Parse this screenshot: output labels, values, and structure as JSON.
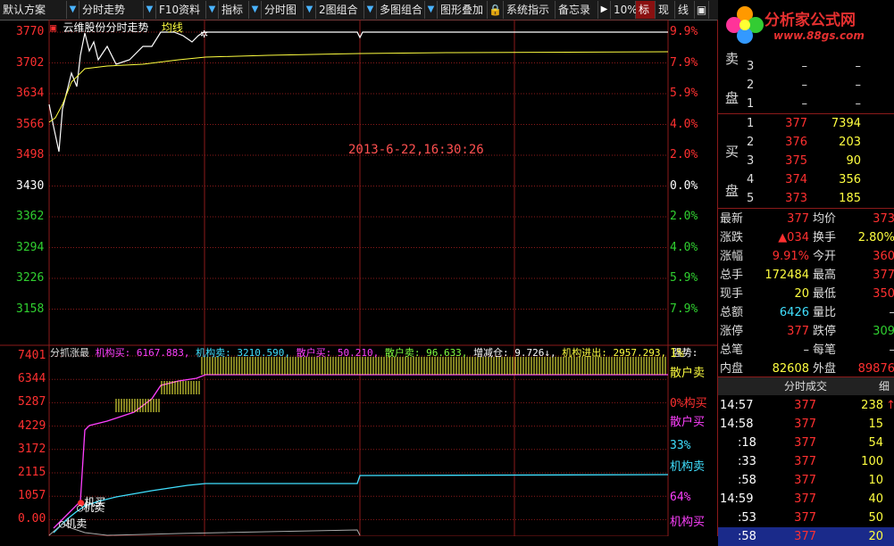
{
  "toolbar": {
    "items": [
      "默认方案",
      "分时走势",
      "F10资料",
      "指标",
      "分时图",
      "2图组合",
      "多图组合",
      "图形叠加",
      "系统指示",
      "备忘录",
      "10%",
      "标",
      "现",
      "线"
    ],
    "lock_label": "🔒"
  },
  "logo": {
    "name": "分析家公式网",
    "url": "www.88gs.com"
  },
  "colors": {
    "up": "#ff3030",
    "down": "#30d030",
    "flat": "#ffffff",
    "yellow": "#ffff40",
    "cyan": "#40e0ff",
    "magenta": "#ff40ff",
    "grid": "#8b1a1a"
  },
  "upper_chart": {
    "title_prefix": "云维股份分时走势",
    "avg_label": "均线",
    "timestamp": "2013-6-22,16:30:26",
    "price_ticks": [
      "3770",
      "3702",
      "3634",
      "3566",
      "3498",
      "3430",
      "3362",
      "3294",
      "3226",
      "3158"
    ],
    "pct_ticks": [
      "9.9%",
      "7.9%",
      "5.9%",
      "4.0%",
      "2.0%",
      "0.0%",
      "2.0%",
      "4.0%",
      "5.9%",
      "7.9%"
    ]
  },
  "lower_chart": {
    "legend": {
      "name": "分抓涨最",
      "inst_buy": "机构买: 6167.883,",
      "inst_sell": "机构卖: 3210.590,",
      "retail_buy": "散户买: 50.210,",
      "retail_sell": "散户卖: 96.633,",
      "position": "增减仓: 9.726↓,",
      "net": "机构进出: 2957.293,",
      "strength": "强势:"
    },
    "y_ticks": [
      "7401",
      "6344",
      "5287",
      "4229",
      "3172",
      "2115",
      "1057",
      "0.00"
    ],
    "right_labels": [
      "1%",
      "散户卖",
      "0%构买",
      "散户买",
      "33%",
      "机构卖",
      "64%",
      "机构买"
    ],
    "inline_labels": {
      "inst_buy": "机买",
      "inst_sell": "机卖",
      "inst_sell2": "机卖"
    }
  },
  "order_book": {
    "sell_label": "卖",
    "pan_label": "盘",
    "buy_label": "买",
    "sell_rows": [
      {
        "n": "3",
        "price": "–",
        "vol": "–"
      },
      {
        "n": "2",
        "price": "–",
        "vol": "–"
      },
      {
        "n": "1",
        "price": "–",
        "vol": "–"
      }
    ],
    "buy_rows": [
      {
        "n": "1",
        "price": "377",
        "vol": "7394"
      },
      {
        "n": "2",
        "price": "376",
        "vol": "203"
      },
      {
        "n": "3",
        "price": "375",
        "vol": "90"
      },
      {
        "n": "4",
        "price": "374",
        "vol": "356"
      },
      {
        "n": "5",
        "price": "373",
        "vol": "185"
      }
    ]
  },
  "quote": [
    {
      "l1": "最新",
      "v1": "377",
      "l2": "均价",
      "v2": "373"
    },
    {
      "l1": "涨跌",
      "v1": "▲034",
      "l2": "换手",
      "v2": "2.80%"
    },
    {
      "l1": "涨幅",
      "v1": "9.91%",
      "l2": "今开",
      "v2": "360"
    },
    {
      "l1": "总手",
      "v1": "172484",
      "l2": "最高",
      "v2": "377"
    },
    {
      "l1": "现手",
      "v1": "20",
      "l2": "最低",
      "v2": "350"
    },
    {
      "l1": "总额",
      "v1": "6426",
      "l2": "量比",
      "v2": "–"
    },
    {
      "l1": "涨停",
      "v1": "377",
      "l2": "跌停",
      "v2": "309"
    },
    {
      "l1": "总笔",
      "v1": "–",
      "l2": "每笔",
      "v2": "–"
    },
    {
      "l1": "内盘",
      "v1": "82608",
      "l2": "外盘",
      "v2": "89876"
    }
  ],
  "ticks_panel": {
    "title": "分时成交",
    "detail_btn": "细",
    "rows": [
      {
        "t": "14:57",
        "p": "377",
        "v": "238",
        "s": "↑"
      },
      {
        "t": "14:58",
        "p": "377",
        "v": "15",
        "s": ""
      },
      {
        "t": ":18",
        "p": "377",
        "v": "54",
        "s": ""
      },
      {
        "t": ":33",
        "p": "377",
        "v": "100",
        "s": ""
      },
      {
        "t": ":58",
        "p": "377",
        "v": "10",
        "s": ""
      },
      {
        "t": "14:59",
        "p": "377",
        "v": "40",
        "s": ""
      },
      {
        "t": ":53",
        "p": "377",
        "v": "50",
        "s": ""
      },
      {
        "t": ":58",
        "p": "377",
        "v": "20",
        "s": ""
      }
    ]
  }
}
